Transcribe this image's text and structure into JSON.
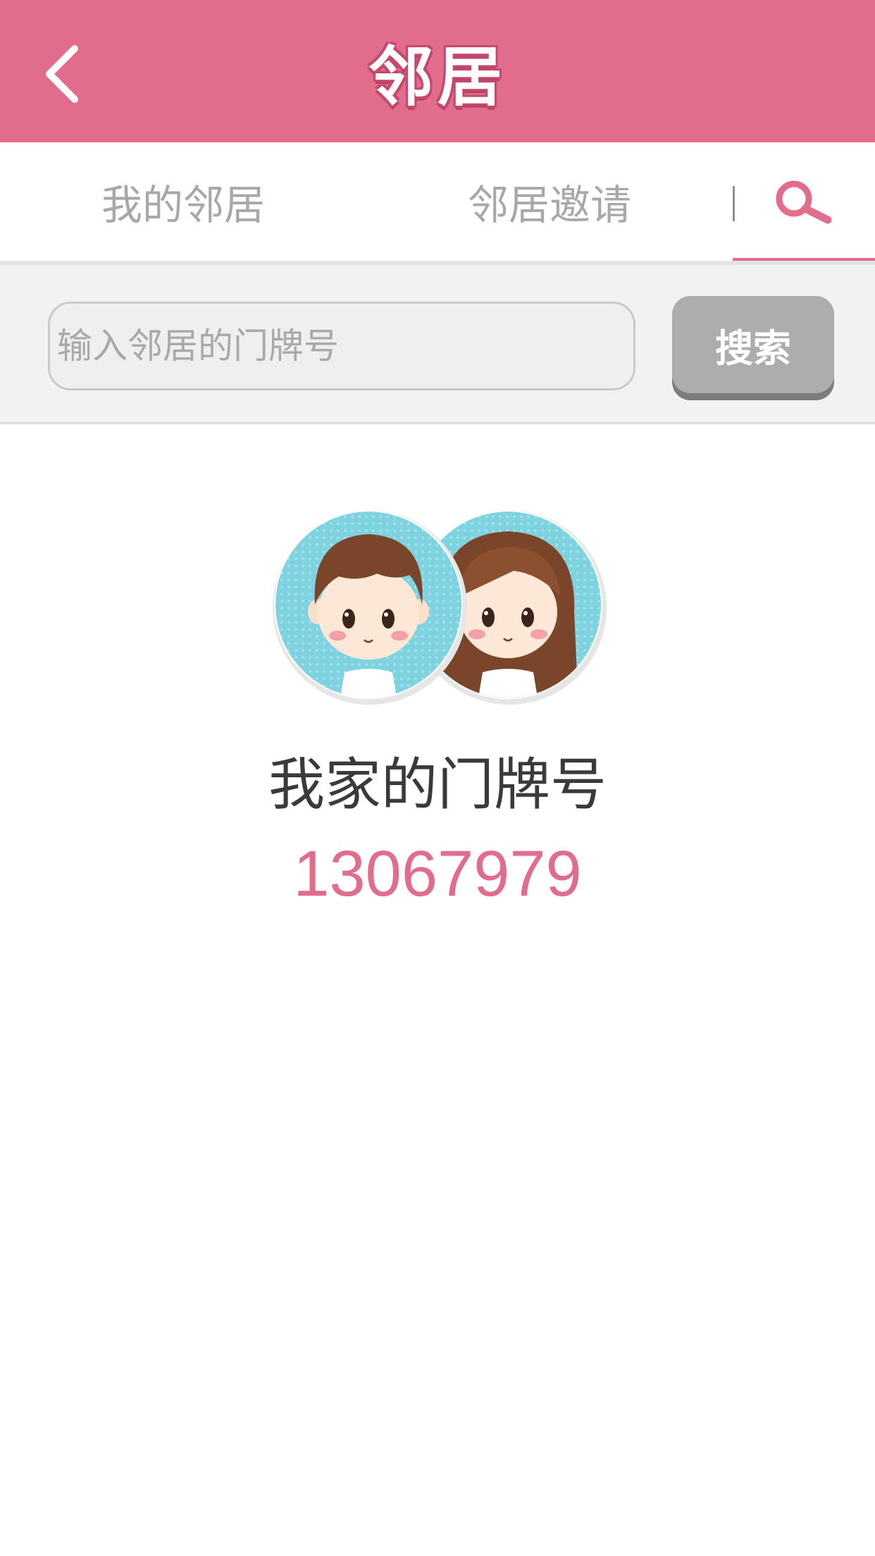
{
  "header": {
    "title": "邻居",
    "back_icon": "chevron-left-icon",
    "background_color": "#e26c8c"
  },
  "tabs": [
    {
      "label": "我的邻居",
      "active": false
    },
    {
      "label": "邻居邀请",
      "active": false
    },
    {
      "icon": "search-icon",
      "active": true
    }
  ],
  "search": {
    "placeholder": "输入邻居的门牌号",
    "value": "",
    "button_label": "搜索"
  },
  "profile": {
    "avatar_icons": [
      "boy-avatar-icon",
      "girl-avatar-icon"
    ],
    "door_label": "我家的门牌号",
    "door_number": "13067979"
  },
  "colors": {
    "accent": "#e26c8c",
    "avatar_bg": "#7fd3e0"
  }
}
